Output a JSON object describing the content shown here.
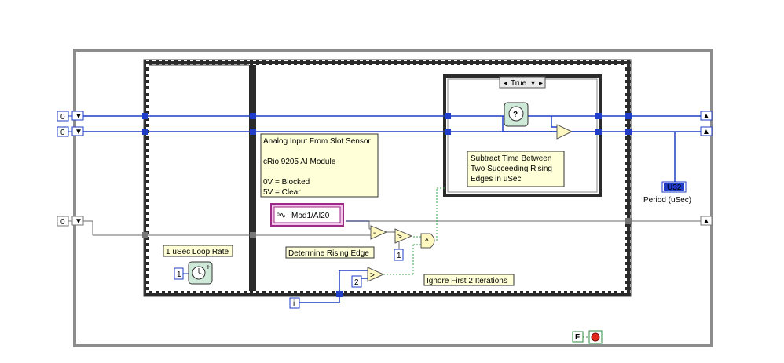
{
  "controls": {
    "left_const_1": "0",
    "left_const_2": "0",
    "left_const_3": "0"
  },
  "case_structure": {
    "selector": "True"
  },
  "comments": {
    "analog_input_lines": [
      "Analog Input From Slot Sensor",
      "",
      "cRio 9205 AI Module",
      "",
      "0V = Blocked",
      "5V = Clear"
    ],
    "subtract_lines": [
      "Subtract Time Between",
      "Two Succeeding Rising",
      "Edges in uSec"
    ],
    "loop_rate": "1 uSec Loop Rate",
    "rising_edge": "Determine Rising Edge",
    "ignore_first": "Ignore First 2 Iterations"
  },
  "io": {
    "channel": "Mod1/AI20",
    "indicator_type": "U32",
    "indicator_label": "Period (uSec)"
  },
  "constants": {
    "wait_value": "1",
    "compare_value": "1",
    "iteration_value": "2",
    "iteration_terminal": "i",
    "stop_constant": "F"
  },
  "operators": {
    "subtract": "-",
    "greater_rising": ">",
    "and": "^",
    "greater_iter": ">",
    "greater_case": ">"
  },
  "colors": {
    "wire_u32": "#1f3dc7",
    "wire_dbl": "#f07a12",
    "wire_bool": "#3aa64a",
    "loop_border": "#9aa0a6",
    "comment_bg": "#ffffd8"
  }
}
